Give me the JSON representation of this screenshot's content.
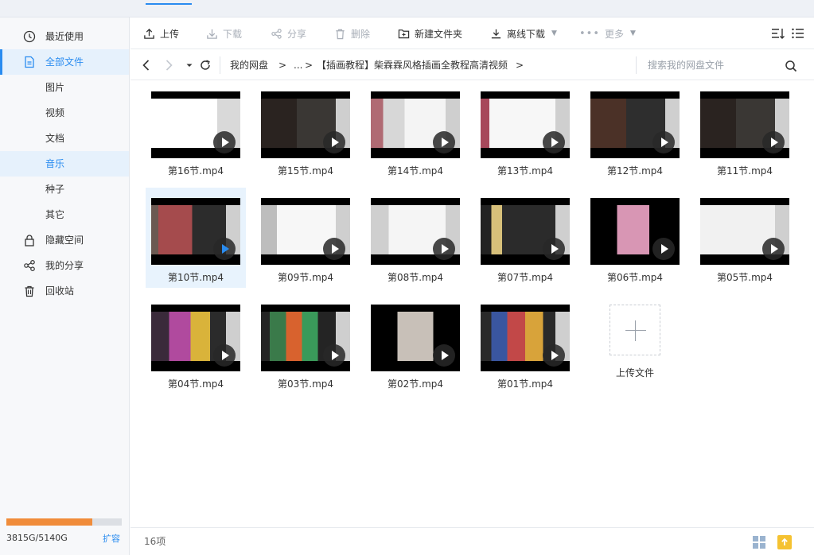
{
  "sidebar": {
    "items": [
      {
        "label": "最近使用",
        "icon": "clock-icon"
      },
      {
        "label": "全部文件",
        "icon": "file-icon"
      },
      {
        "label": "图片"
      },
      {
        "label": "视频"
      },
      {
        "label": "文档"
      },
      {
        "label": "音乐"
      },
      {
        "label": "种子"
      },
      {
        "label": "其它"
      },
      {
        "label": "隐藏空间",
        "icon": "lock-icon"
      },
      {
        "label": "我的分享",
        "icon": "share-icon"
      },
      {
        "label": "回收站",
        "icon": "trash-icon"
      }
    ],
    "quota": {
      "text": "3815G/5140G",
      "used": 3815,
      "total": 5140,
      "expand_label": "扩容"
    }
  },
  "toolbar": {
    "upload": "上传",
    "download": "下载",
    "share": "分享",
    "delete": "删除",
    "new_folder": "新建文件夹",
    "offline_download": "离线下载",
    "more": "更多"
  },
  "nav": {
    "crumbs": [
      "我的网盘",
      "...",
      "【插画教程】柴霖霖风格插画全教程高清视频"
    ],
    "search_placeholder": "搜索我的网盘文件"
  },
  "files": [
    {
      "name": "第16节.mp4"
    },
    {
      "name": "第15节.mp4"
    },
    {
      "name": "第14节.mp4"
    },
    {
      "name": "第13节.mp4"
    },
    {
      "name": "第12节.mp4"
    },
    {
      "name": "第11节.mp4"
    },
    {
      "name": "第10节.mp4"
    },
    {
      "name": "第09节.mp4"
    },
    {
      "name": "第08节.mp4"
    },
    {
      "name": "第07节.mp4"
    },
    {
      "name": "第06节.mp4"
    },
    {
      "name": "第05节.mp4"
    },
    {
      "name": "第04节.mp4"
    },
    {
      "name": "第03节.mp4"
    },
    {
      "name": "第02节.mp4"
    },
    {
      "name": "第01节.mp4"
    }
  ],
  "upload_tile": {
    "label": "上传文件"
  },
  "status": {
    "count": "16项"
  },
  "colors": {
    "accent": "#2a8cf0",
    "quota_fill": "#f08c3a",
    "sidebar_bg": "#f7f8fa",
    "active_bg": "#e6f1fc"
  }
}
